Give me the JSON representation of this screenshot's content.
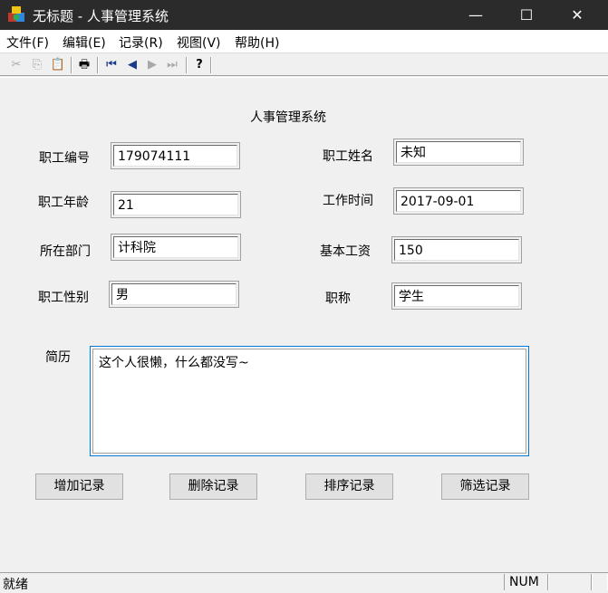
{
  "window": {
    "title": "无标题 - 人事管理系统",
    "minimize": "—",
    "maximize": "☐",
    "close": "✕"
  },
  "menu": [
    "文件(F)",
    "编辑(E)",
    "记录(R)",
    "视图(V)",
    "帮助(H)"
  ],
  "toolbar": {
    "cut": "✂",
    "copy": "⎘",
    "paste": "📋",
    "print": "🖶",
    "first": "⏮",
    "prev": "◀",
    "next": "▶",
    "last": "⏭",
    "help": "?"
  },
  "form": {
    "heading": "人事管理系统",
    "emp_no_label": "职工编号",
    "emp_no": "179074111",
    "emp_name_label": "职工姓名",
    "emp_name": "未知",
    "age_label": "职工年龄",
    "age": "21",
    "work_time_label": "工作时间",
    "work_time": "2017-09-01",
    "dept_label": "所在部门",
    "dept": "计科院",
    "salary_label": "基本工资",
    "salary": "150",
    "gender_label": "职工性别",
    "gender": "男",
    "title_label": "职称",
    "title": "学生",
    "resume_label": "简历",
    "resume": "这个人很懒，什么都没写~"
  },
  "buttons": {
    "add": "增加记录",
    "delete": "删除记录",
    "sort": "排序记录",
    "filter": "筛选记录"
  },
  "status": {
    "ready": "就绪",
    "num": "NUM"
  }
}
